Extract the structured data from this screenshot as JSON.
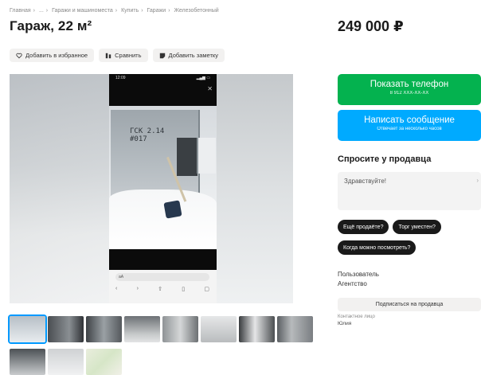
{
  "breadcrumbs": [
    "Главная",
    "...",
    "Гаражи и машиноместа",
    "Купить",
    "Гаражи",
    "Железобетонный"
  ],
  "title": "Гараж, 22 м²",
  "price": "249 000 ₽",
  "actions": {
    "favorite": "Добавить в избранное",
    "compare": "Сравнить",
    "note": "Добавить заметку"
  },
  "photo": {
    "status_time": "12:09",
    "garage_mark": "ГСК 2.14\n#017",
    "url_text": "аA"
  },
  "thumbnails_row1_count": 8,
  "thumbnails_row2_count": 3,
  "contact": {
    "phone_label": "Показать телефон",
    "phone_sub": "8 912 XXX-XX-XX",
    "message_label": "Написать сообщение",
    "message_sub": "Отвечает за несколько часов"
  },
  "ask_seller": {
    "title": "Спросите у продавца",
    "message": "Здравствуйте!",
    "quick_questions": [
      "Ещё продаёте?",
      "Торг уместен?",
      "Когда можно посмотреть?"
    ]
  },
  "seller": {
    "label": "Пользователь",
    "type": "Агентство",
    "subscribe": "Подписаться на продавца",
    "contact_label": "Контактное лицо",
    "contact_name": "Юлия"
  },
  "colors": {
    "green": "#04b24f",
    "blue": "#00aaff",
    "selected_thumb": "#0099ff"
  }
}
